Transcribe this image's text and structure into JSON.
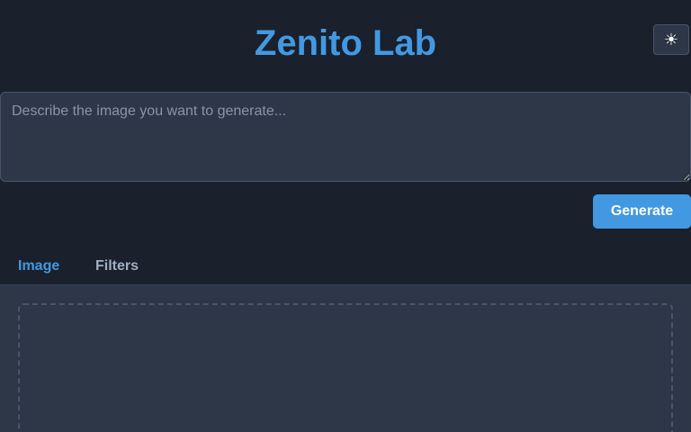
{
  "header": {
    "title": "Zenito Lab",
    "theme_toggle_icon": "sun-icon",
    "theme_toggle_glyph": "☀"
  },
  "prompt": {
    "placeholder": "Describe the image you want to generate...",
    "value": ""
  },
  "actions": {
    "generate_label": "Generate"
  },
  "tabs": [
    {
      "label": "Image",
      "active": true
    },
    {
      "label": "Filters",
      "active": false
    }
  ],
  "colors": {
    "accent": "#4299e1",
    "background": "#1a202c",
    "surface": "#2d3748",
    "border": "#4a5568"
  }
}
